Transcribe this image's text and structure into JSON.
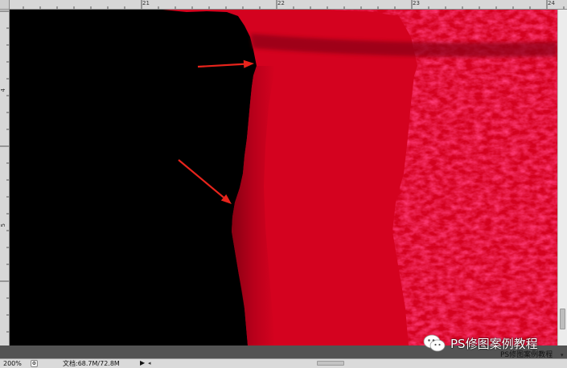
{
  "rulers": {
    "top_labels": [
      "21",
      "22",
      "23",
      "24"
    ],
    "left_labels": [
      "4",
      "5"
    ]
  },
  "canvas": {
    "colors": {
      "background": "#000000",
      "knit_dark": "#8a0012",
      "knit": "#d4021f",
      "knit_bright": "#ff1a3a",
      "arrow": "#e8241c"
    },
    "arrows": [
      {
        "name": "arrow-upper"
      },
      {
        "name": "arrow-lower"
      }
    ]
  },
  "status": {
    "zoom": "200%",
    "zoom_icon": "⚙",
    "doc_info": "文档:68.7M/72.8M",
    "arrow": "▶",
    "scroll_left": "◂"
  },
  "watermark": {
    "icon": "wechat-icon",
    "text": "PS修图案例教程"
  },
  "caption": {
    "text": "PS修图案例教程",
    "icon": "▾"
  }
}
